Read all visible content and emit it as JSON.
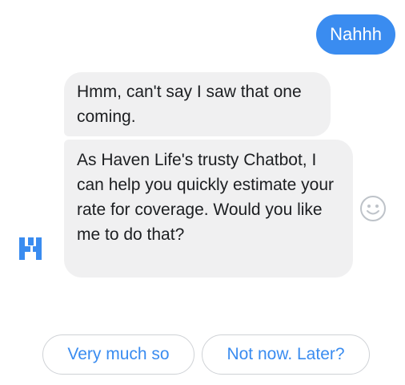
{
  "conversation": {
    "user_message": "Nahhh",
    "bot_message_1": "Hmm, can't say I saw that one coming.",
    "bot_message_2": "As Haven Life's trusty Chatbot, I can help you quickly estimate your rate for coverage. Would you like me to do that?"
  },
  "quick_replies": [
    {
      "label": "Very much so"
    },
    {
      "label": "Not now. Later?"
    }
  ],
  "icons": {
    "reaction": "smiley-face-icon",
    "avatar": "haven-life-logo"
  },
  "colors": {
    "user_bubble": "#3a8cf0",
    "bot_bubble": "#f0f0f1",
    "bot_text": "#1c1e21",
    "quick_reply_text": "#3a8cf0",
    "quick_reply_border": "#cfd2d6",
    "logo": "#3a8cf0"
  }
}
